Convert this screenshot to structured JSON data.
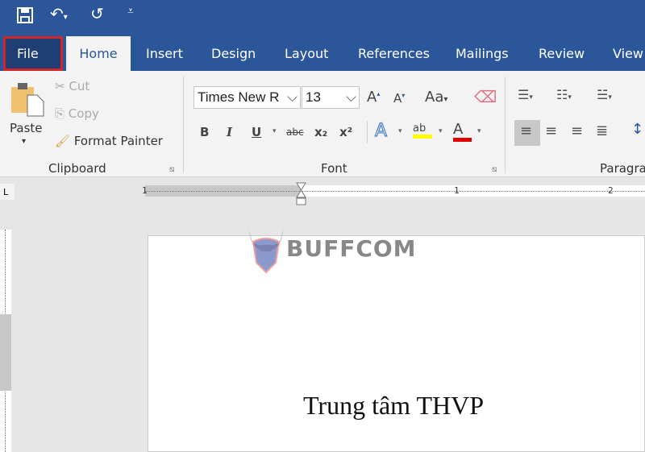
{
  "quick_access": {
    "save_icon": "save-icon",
    "undo_icon": "undo-icon",
    "redo_icon": "redo-icon",
    "customize_icon": "customize-qat-icon"
  },
  "tabs": [
    {
      "label": "File"
    },
    {
      "label": "Home"
    },
    {
      "label": "Insert"
    },
    {
      "label": "Design"
    },
    {
      "label": "Layout"
    },
    {
      "label": "References"
    },
    {
      "label": "Mailings"
    },
    {
      "label": "Review"
    },
    {
      "label": "View"
    }
  ],
  "clipboard": {
    "paste": "Paste",
    "cut": "Cut",
    "copy": "Copy",
    "format_painter": "Format Painter",
    "label": "Clipboard"
  },
  "font": {
    "name": "Times New R",
    "size": "13",
    "label": "Font",
    "case": "Aa",
    "bold": "B",
    "italic": "I",
    "underline": "U",
    "strike": "abc",
    "sub": "x₂",
    "sup": "x²",
    "effects": "A",
    "highlight": "ab",
    "color": "A",
    "highlight_color": "#ffff00",
    "font_color": "#e00000"
  },
  "paragraph": {
    "label": "Paragra"
  },
  "ruler": {
    "ticks": [
      "1",
      "1",
      "2"
    ]
  },
  "document": {
    "text": "Trung tâm THVP"
  },
  "watermark": "BUFFCOM",
  "colors": {
    "accent": "#2b579a",
    "file_highlight": "#d0272d"
  }
}
